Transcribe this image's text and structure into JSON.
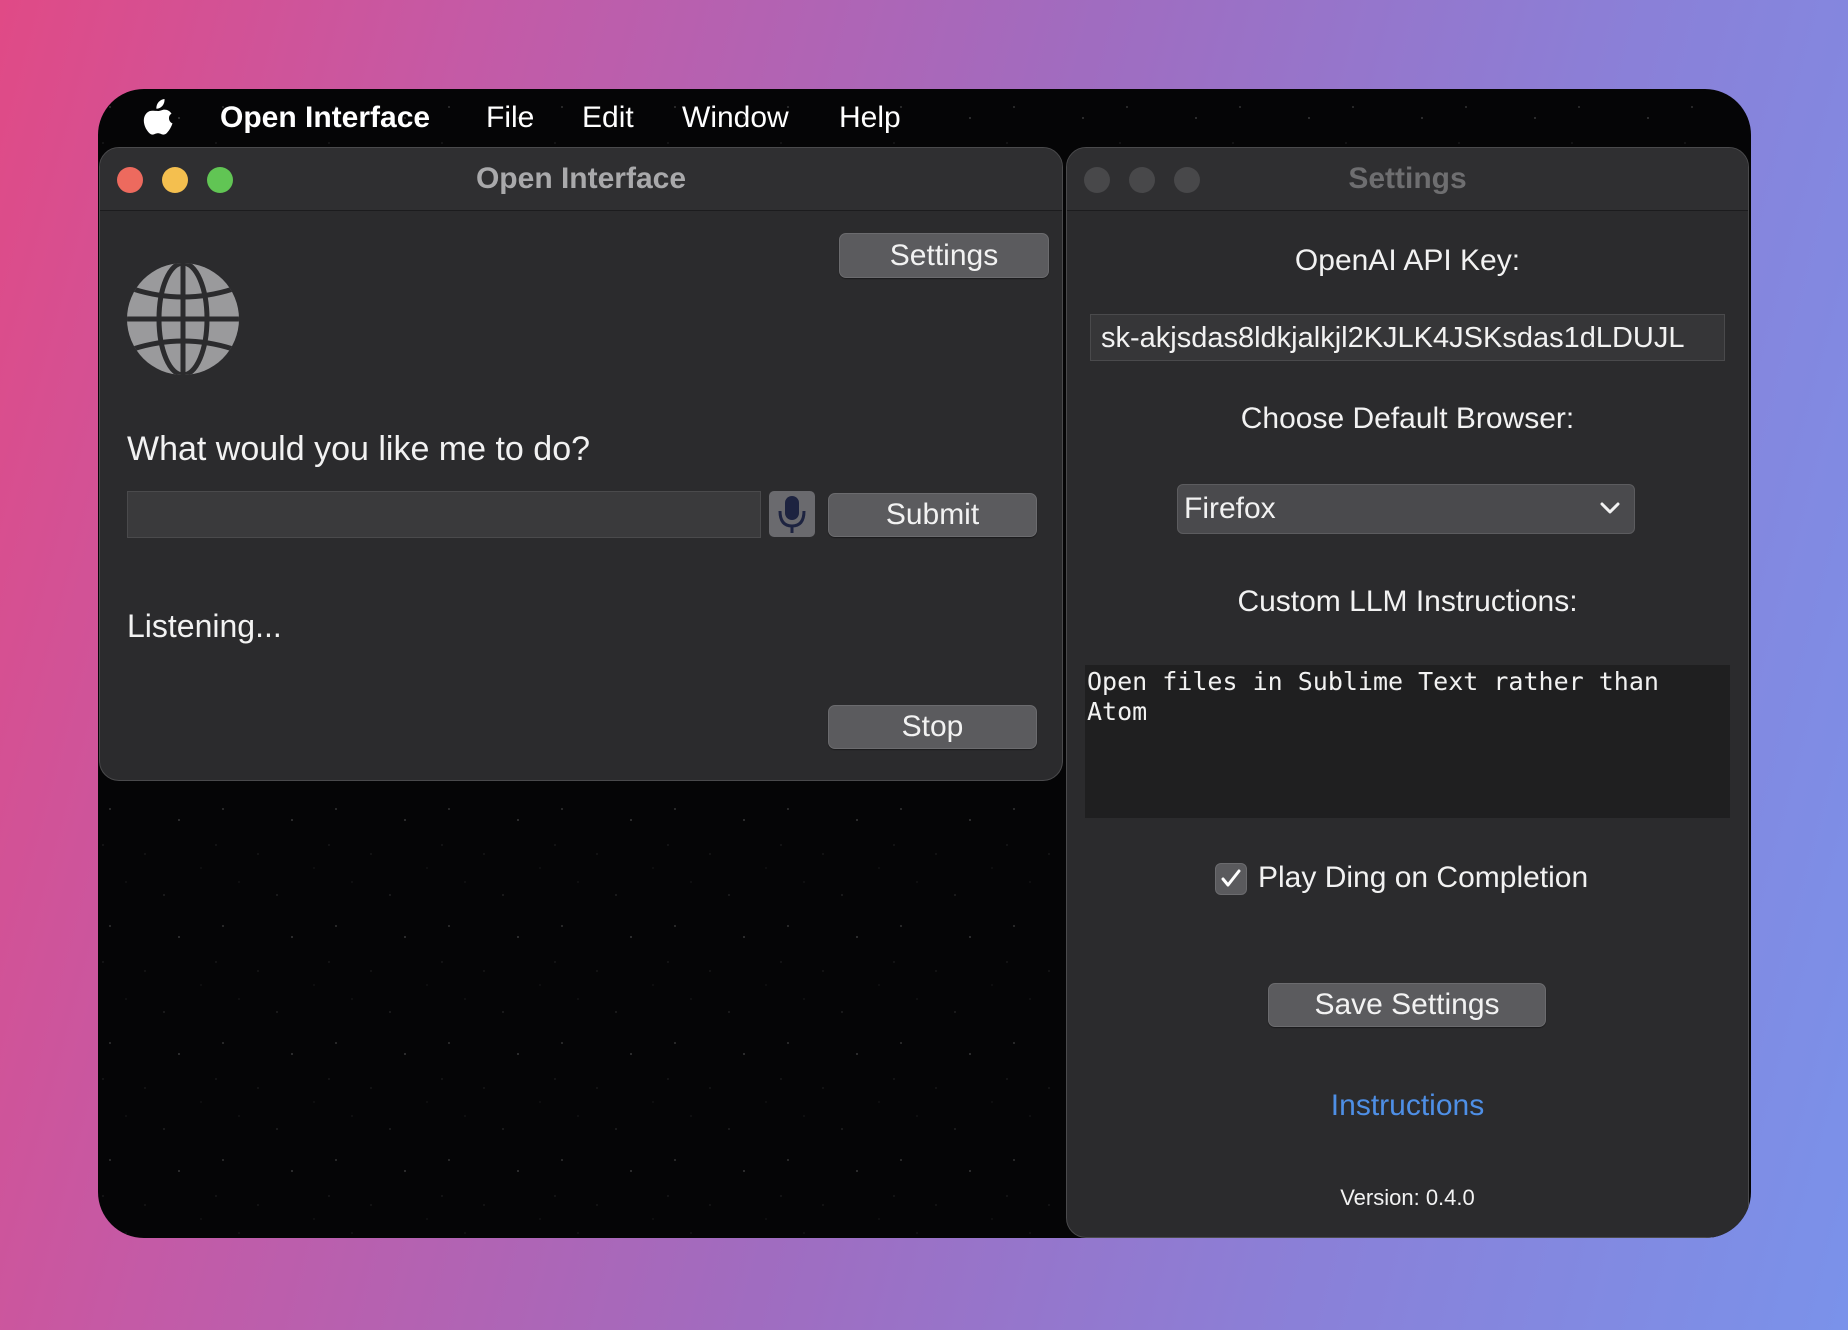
{
  "menubar": {
    "apple_icon": "apple-logo-icon",
    "app_name": "Open Interface",
    "items": [
      "File",
      "Edit",
      "Window",
      "Help"
    ]
  },
  "main_window": {
    "title": "Open Interface",
    "settings_button": "Settings",
    "globe_icon": "globe-icon",
    "prompt": "What would you like me to do?",
    "input_value": "",
    "mic_icon": "microphone-icon",
    "submit_button": "Submit",
    "status": "Listening...",
    "stop_button": "Stop"
  },
  "settings_window": {
    "title": "Settings",
    "api_key_label": "OpenAI API Key:",
    "api_key_value": "sk-akjsdas8ldkjalkjl2KJLK4JSKsdas1dLDUJL",
    "browser_label": "Choose Default Browser:",
    "browser_selected": "Firefox",
    "instructions_label": "Custom LLM Instructions:",
    "instructions_value": "Open files in Sublime Text rather than Atom",
    "ding_checkbox_label": "Play Ding on Completion",
    "ding_checked": true,
    "save_button": "Save Settings",
    "instructions_link": "Instructions",
    "version": "Version: 0.4.0"
  },
  "colors": {
    "traffic_close": "#ed6a5e",
    "traffic_minimize": "#f4bf4f",
    "traffic_zoom": "#61c554",
    "link": "#4e8fe6",
    "window_bg": "#2b2b2d"
  }
}
